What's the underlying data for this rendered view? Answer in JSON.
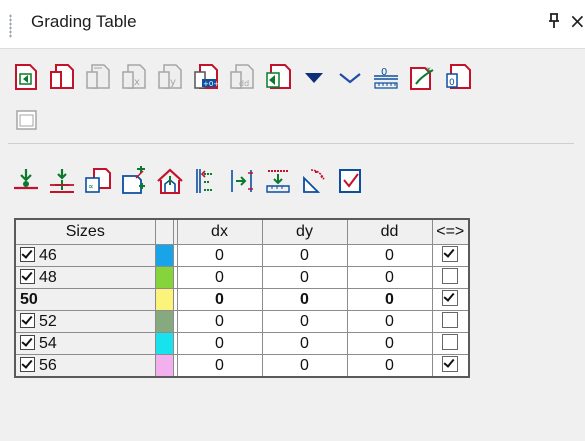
{
  "window": {
    "title": "Grading Table",
    "pin_glyph": "p",
    "close_glyph": "×"
  },
  "toolbar1": [
    {
      "name": "paste-grading-icon"
    },
    {
      "name": "copy-grading-icon"
    },
    {
      "name": "paste-grading-disabled-icon"
    },
    {
      "name": "paste-x-disabled-icon"
    },
    {
      "name": "paste-y-disabled-icon"
    },
    {
      "name": "paste-xy-icon"
    },
    {
      "name": "paste-dd-disabled-icon"
    },
    {
      "name": "paste-special-icon"
    },
    {
      "name": "dropdown-triangle-icon"
    },
    {
      "name": "collapse-chevron-icon"
    },
    {
      "name": "measure-zero-icon"
    },
    {
      "name": "angle-grading-icon"
    },
    {
      "name": "paste-value-icon"
    }
  ],
  "toolbar1b": [
    {
      "name": "window-disabled-icon"
    }
  ],
  "toolbar2": [
    {
      "name": "insert-point-above-icon"
    },
    {
      "name": "insert-point-plus-icon"
    },
    {
      "name": "angle-copy-icon"
    },
    {
      "name": "stretch-grading-icon"
    },
    {
      "name": "house-grading-icon"
    },
    {
      "name": "align-left-icon"
    },
    {
      "name": "align-right-icon"
    },
    {
      "name": "distribute-icon"
    },
    {
      "name": "transform-triangle-icon"
    },
    {
      "name": "checkbox-page-icon"
    }
  ],
  "grid": {
    "headers": {
      "sizes": "Sizes",
      "dx": "dx",
      "dy": "dy",
      "dd": "dd",
      "eq": "<=>"
    },
    "rows": [
      {
        "size": "46",
        "checked": true,
        "color": "#19a3e8",
        "dx": "0",
        "dy": "0",
        "dd": "0",
        "eq": true,
        "base": false
      },
      {
        "size": "48",
        "checked": true,
        "color": "#86d43c",
        "dx": "0",
        "dy": "0",
        "dd": "0",
        "eq": false,
        "base": false
      },
      {
        "size": "50",
        "checked": false,
        "color": "#fbf37a",
        "dx": "0",
        "dy": "0",
        "dd": "0",
        "eq": true,
        "base": true
      },
      {
        "size": "52",
        "checked": true,
        "color": "#86a97f",
        "dx": "0",
        "dy": "0",
        "dd": "0",
        "eq": false,
        "base": false
      },
      {
        "size": "54",
        "checked": true,
        "color": "#19e2ef",
        "dx": "0",
        "dy": "0",
        "dd": "0",
        "eq": false,
        "base": false
      },
      {
        "size": "56",
        "checked": true,
        "color": "#f2b0ee",
        "dx": "0",
        "dy": "0",
        "dd": "0",
        "eq": true,
        "base": false
      }
    ]
  }
}
